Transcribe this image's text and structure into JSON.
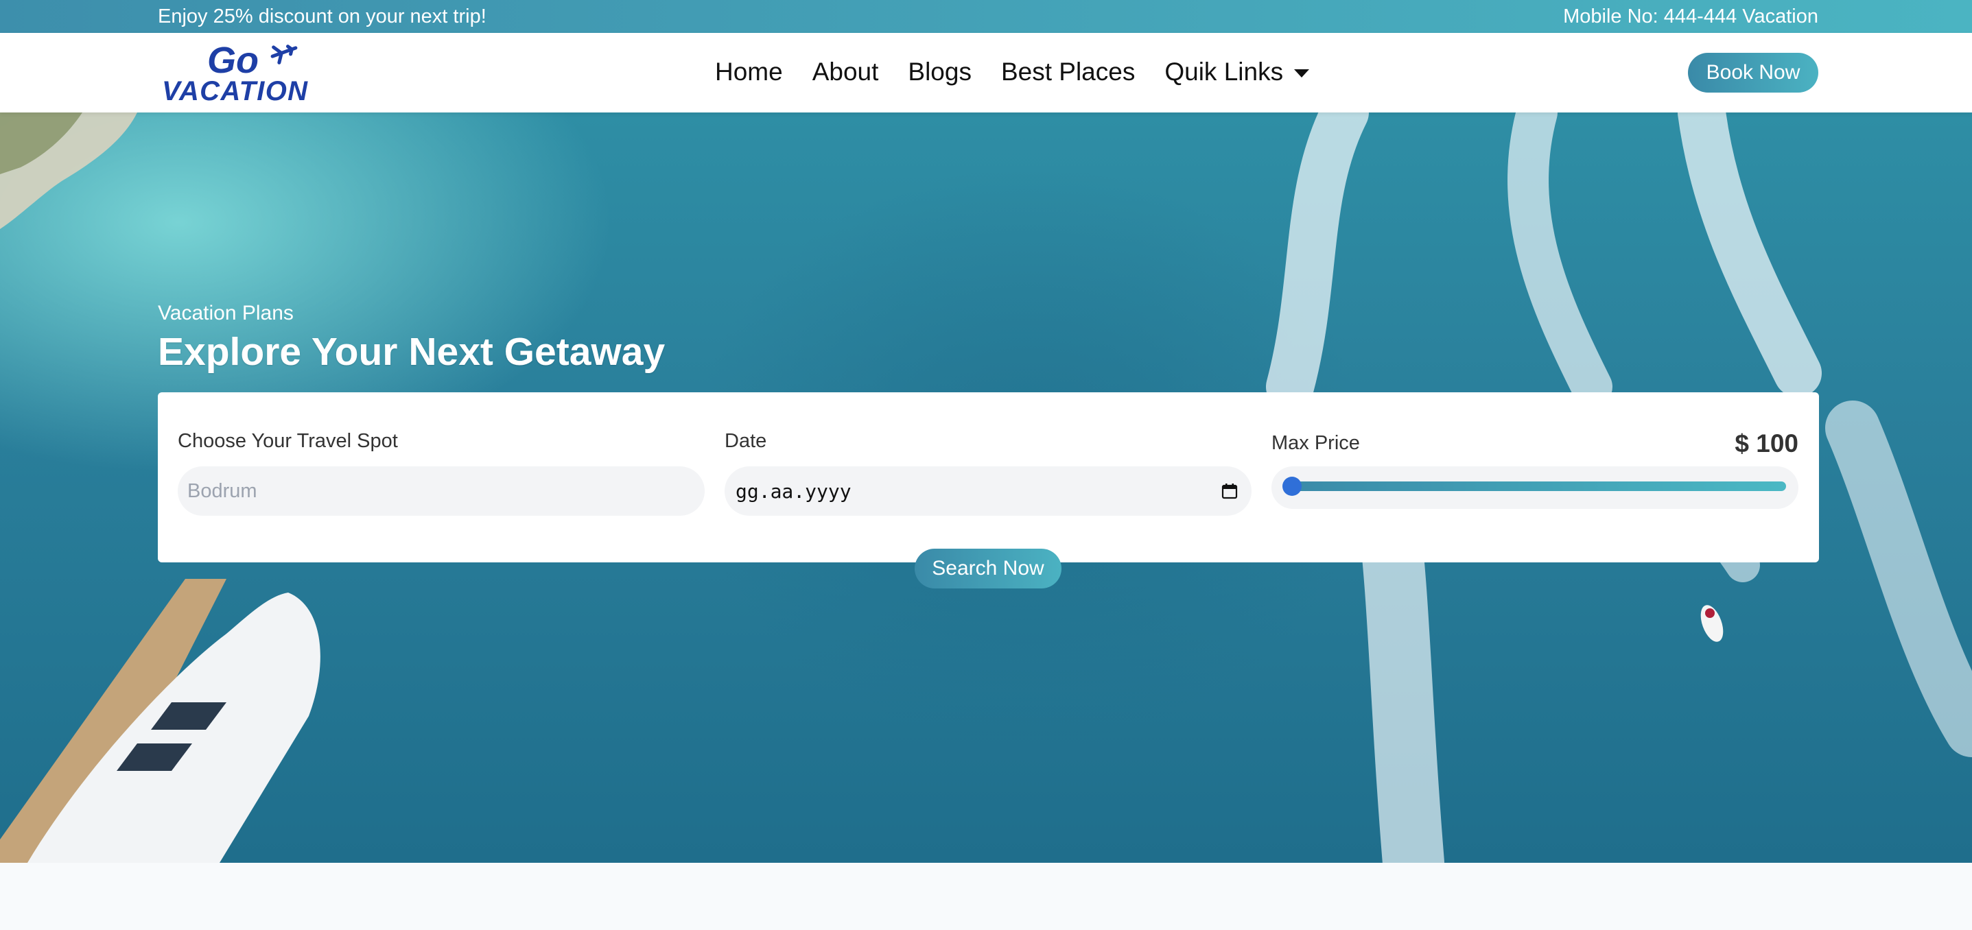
{
  "topbar": {
    "promo": "Enjoy 25% discount on your next trip!",
    "phone": "Mobile No: 444-444 Vacation"
  },
  "logo": {
    "line1": "Go",
    "line2": "VACATION",
    "icon": "airplane-icon"
  },
  "nav": {
    "items": [
      "Home",
      "About",
      "Blogs",
      "Best Places",
      "Quik Links"
    ],
    "book_now": "Book Now"
  },
  "hero": {
    "subtitle": "Vacation Plans",
    "title": "Explore Your Next Getaway"
  },
  "search": {
    "spot_label": "Choose Your Travel Spot",
    "spot_placeholder": "Bodrum",
    "date_label": "Date",
    "date_value": "gg.aa.yyyy",
    "price_label": "Max Price",
    "price_value": "$ 100",
    "price_slider_fraction": 0.0,
    "button": "Search Now"
  },
  "colors": {
    "accent_start": "#3a8aa8",
    "accent_end": "#4bb2c2",
    "slider_thumb": "#2f6fd8"
  }
}
